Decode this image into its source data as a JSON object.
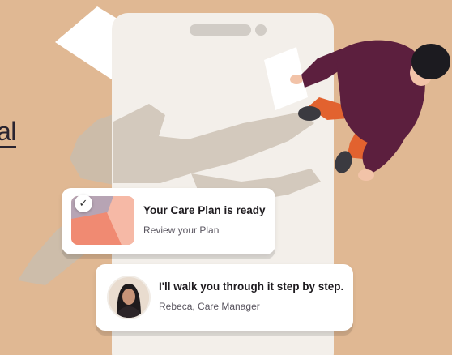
{
  "background_color": "#E0B893",
  "partial_link": {
    "text": "al"
  },
  "notifications": {
    "plan": {
      "title": "Your Care Plan is ready",
      "subtitle": "Review your Plan",
      "badge_icon": "checkmark-icon",
      "badge_glyph": "✓"
    },
    "message": {
      "title": "I'll walk you through it step by step.",
      "sender": "Rebeca, Care Manager",
      "avatar_icon": "care-manager-photo"
    }
  },
  "colors": {
    "phone": "#F3EFEA",
    "shadow": "#C9BDAE",
    "person_shirt": "#5C1F3E",
    "person_pants": "#E2622F",
    "person_shoes": "#3B3A40",
    "thumb_salmon": "#F08A72",
    "thumb_peach": "#F6B9A6",
    "thumb_mauve": "#B7A4B4"
  }
}
